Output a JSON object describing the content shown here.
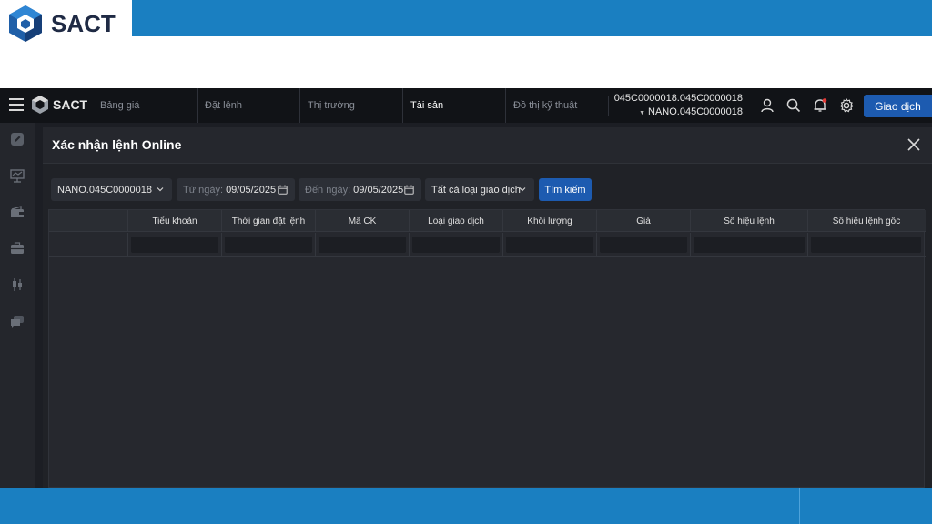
{
  "slide": {
    "logo_text": "SACT"
  },
  "header": {
    "logo_text": "SACT",
    "nav": [
      {
        "label": "Bảng giá",
        "active": false
      },
      {
        "label": "Đặt lệnh",
        "active": false
      },
      {
        "label": "Thị trường",
        "active": false
      },
      {
        "label": "Tài sản",
        "active": true
      },
      {
        "label": "Đồ thị kỹ thuật",
        "active": false
      }
    ],
    "account_line1": "045C0000018.045C0000018",
    "account_line2": "NANO.045C0000018",
    "trade_button": "Giao dịch"
  },
  "panel": {
    "title": "Xác nhận lệnh Online",
    "filters": {
      "account": "NANO.045C0000018",
      "from_label": "Từ ngày:",
      "from_value": "09/05/2025",
      "to_label": "Đến ngày:",
      "to_value": "09/05/2025",
      "type": "Tất cả loại giao dịch",
      "search_button": "Tìm kiếm"
    },
    "table": {
      "columns": [
        "Tiểu khoản",
        "Thời gian đặt lệnh",
        "Mã CK",
        "Loại giao dịch",
        "Khối lượng",
        "Giá",
        "Số hiệu lệnh",
        "Số hiệu lệnh gốc"
      ]
    }
  },
  "colors": {
    "frame_blue": "#1a7fc1",
    "app_bg": "#1c1e24",
    "accent": "#1d5bb0"
  }
}
